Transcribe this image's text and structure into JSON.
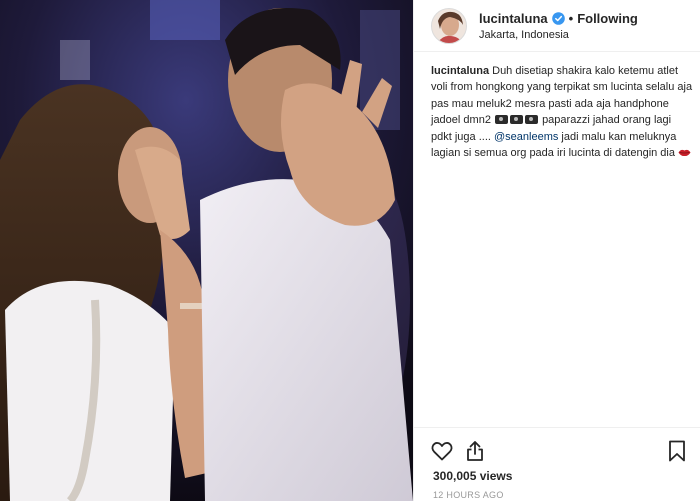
{
  "post": {
    "username": "lucintaluna",
    "follow_state": "Following",
    "separator": "•",
    "location": "Jakarta, Indonesia"
  },
  "caption": {
    "username": "lucintaluna",
    "text_1": "Duh disetiap shakira kalo ketemu atlet voli from hongkong yang terpikat sm lucinta selalu aja pas mau meluk2 mesra pasti ada aja handphone jadoel dmn2",
    "text_2": "paparazzi jahad orang lagi pdkt juga ....",
    "mention": "@seanleems",
    "text_3": "⁠ jadi malu kan meluknya lagian si semua org pada iri lucinta di datengin dia"
  },
  "stats": {
    "views": "300,005 views",
    "timestamp": "12 HOURS AGO"
  },
  "icons": {
    "verified": "verified-badge-icon",
    "like": "heart-icon",
    "share": "share-icon",
    "save": "bookmark-icon",
    "camera": "camera-emoji-icon",
    "lips": "lips-emoji-icon"
  },
  "colors": {
    "verified_blue": "#3897f0",
    "mention": "#003569",
    "muted": "#999999",
    "text": "#262626"
  }
}
